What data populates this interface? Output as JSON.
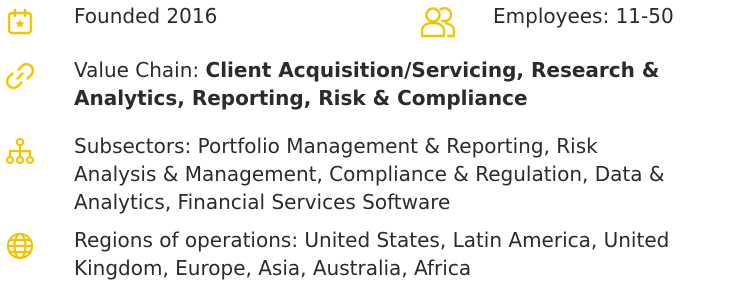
{
  "founded": {
    "icon": "calendar-star-icon",
    "text": "Founded 2016"
  },
  "employees": {
    "icon": "people-icon",
    "text": "Employees: 11-50"
  },
  "value_chain": {
    "icon": "link-icon",
    "prefix": "Value Chain: ",
    "bold_line1": "Client Acquisition/Servicing, Research &",
    "bold_line2": "Analytics, Reporting, Risk & Compliance"
  },
  "subsectors": {
    "icon": "hierarchy-icon",
    "line1": "Subsectors: Portfolio Management & Reporting, Risk",
    "line2": "Analysis & Management, Compliance & Regulation, Data &",
    "line3": "Analytics, Financial Services Software"
  },
  "regions": {
    "icon": "globe-icon",
    "line1": "Regions of operations: United States, Latin America, United",
    "line2": "Kingdom, Europe, Asia, Australia, Africa"
  },
  "colors": {
    "accent": "#f5c400",
    "text": "#2b2b2b"
  }
}
